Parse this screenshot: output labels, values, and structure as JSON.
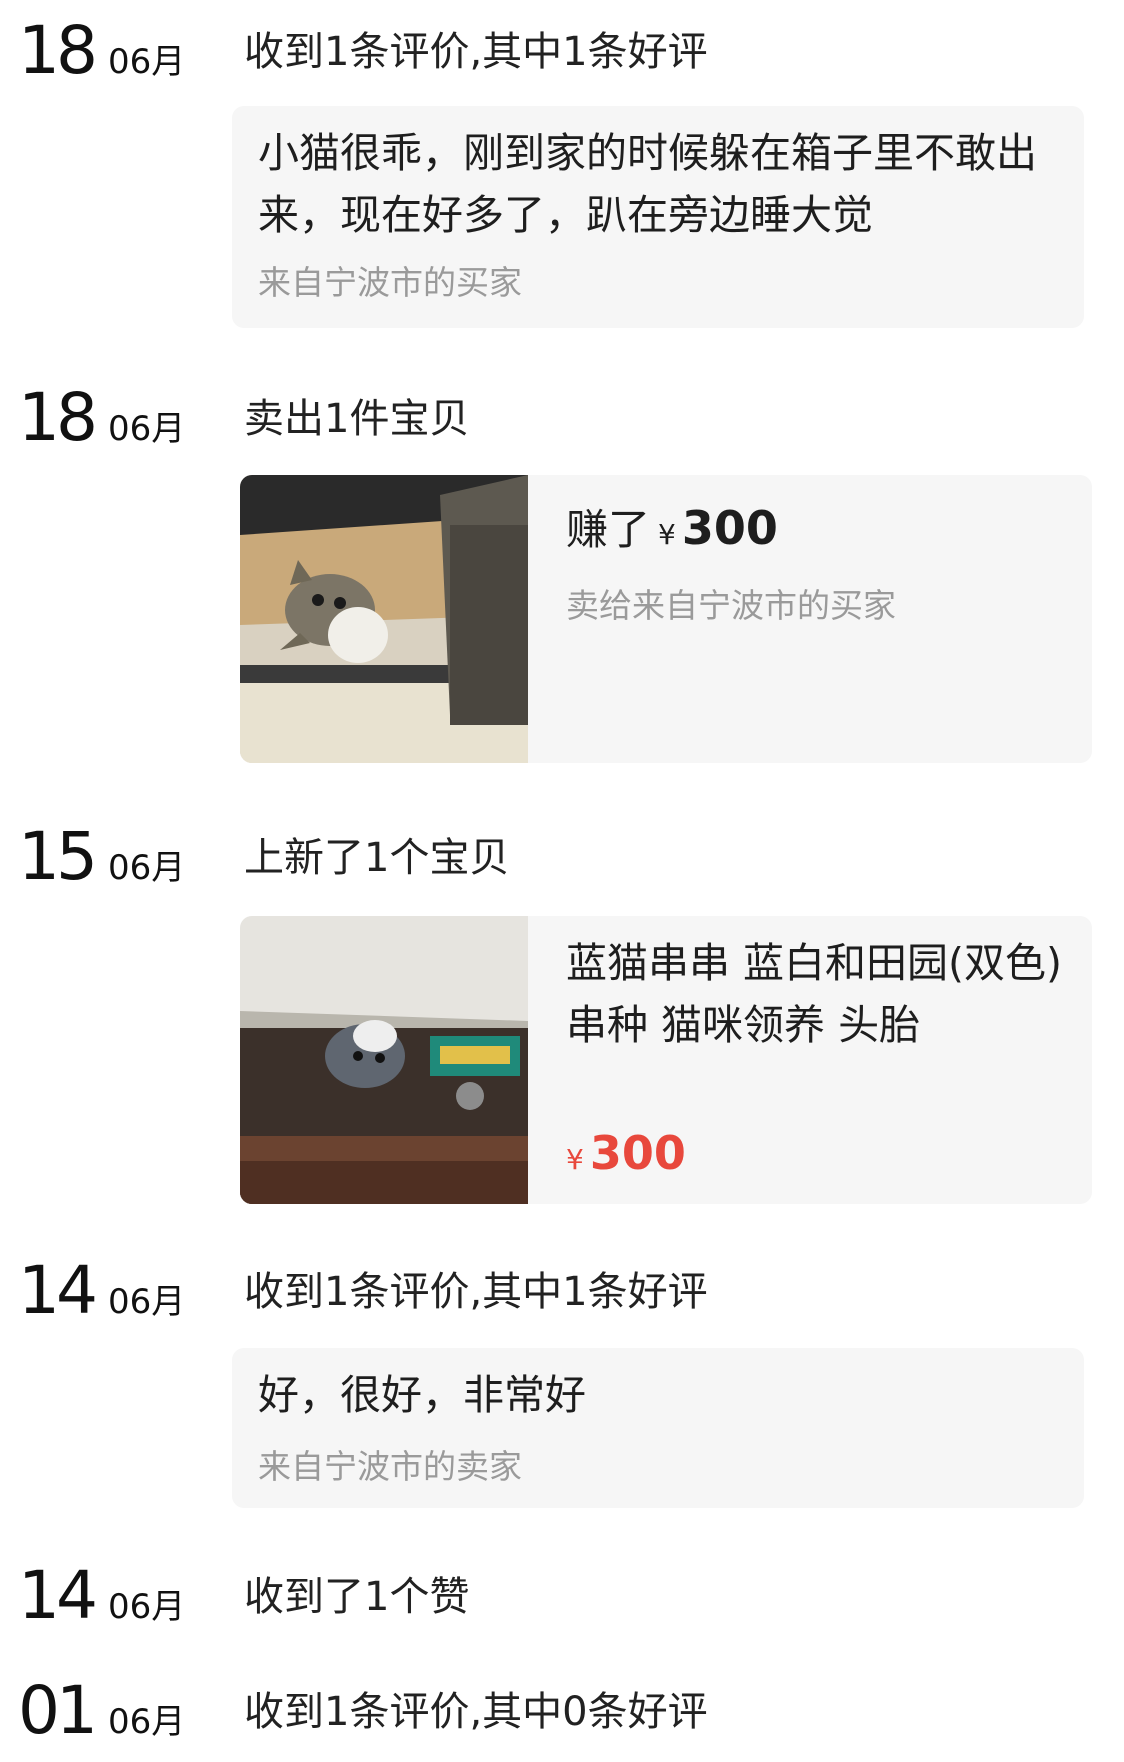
{
  "entries": [
    {
      "day": "18",
      "month": "06月",
      "title": "收到1条评价,其中1条好评",
      "review": {
        "text": "小猫很乖，刚到家的时候躲在箱子里不敢出来，现在好多了，趴在旁边睡大觉",
        "from": "来自宁波市的买家"
      }
    },
    {
      "day": "18",
      "month": "06月",
      "title": "卖出1件宝贝",
      "sale": {
        "earned_label": "赚了",
        "currency": "¥",
        "amount": "300",
        "to": "卖给来自宁波市的买家",
        "photo": "tabby-kitten-in-box-photo"
      }
    },
    {
      "day": "15",
      "month": "06月",
      "title": "上新了1个宝贝",
      "listing": {
        "title": "蓝猫串串 蓝白和田园(双色)串种 猫咪领养 头胎",
        "currency": "¥",
        "price": "300",
        "photo": "kitten-under-cabinet-photo"
      }
    },
    {
      "day": "14",
      "month": "06月",
      "title": "收到1条评价,其中1条好评",
      "review": {
        "text": "好，很好，非常好",
        "from": "来自宁波市的卖家"
      }
    },
    {
      "day": "14",
      "month": "06月",
      "title": "收到了1个赞"
    },
    {
      "day": "01",
      "month": "06月",
      "title": "收到1条评价,其中0条好评"
    }
  ],
  "colors": {
    "price_red": "#e8483c",
    "card_bg": "#f6f6f6",
    "muted_text": "#9a9a9a"
  }
}
